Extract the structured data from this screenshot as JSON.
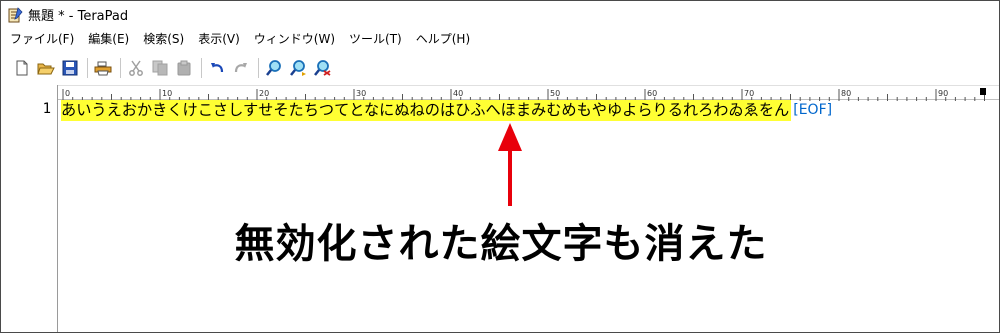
{
  "window": {
    "title": "無題 * - TeraPad",
    "icon": "terapad-notebook-icon"
  },
  "menu": {
    "items": [
      "ファイル(F)",
      "編集(E)",
      "検索(S)",
      "表示(V)",
      "ウィンドウ(W)",
      "ツール(T)",
      "ヘルプ(H)"
    ]
  },
  "toolbar": {
    "buttons": [
      "new-file-icon",
      "open-folder-icon",
      "save-icon",
      "print-icon",
      "cut-icon",
      "copy-icon",
      "paste-icon",
      "undo-icon",
      "redo-icon",
      "find-icon",
      "find-next-icon",
      "replace-icon"
    ]
  },
  "ruler": {
    "labels": [
      "0",
      "10",
      "20",
      "30",
      "40",
      "50",
      "60",
      "70",
      "80",
      "90"
    ]
  },
  "editor": {
    "line_number": "1",
    "line_text": "あいうえおかきくけこさしすせそたちつてとなにぬねのはひふへほまみむめもやゆよらりるれろわゐゑをん",
    "eol_marker": "[EOF]",
    "highlight_color": "#ffff33"
  },
  "annotation": {
    "caption": "無効化された絵文字も消えた",
    "arrow_color": "#e8000b"
  }
}
